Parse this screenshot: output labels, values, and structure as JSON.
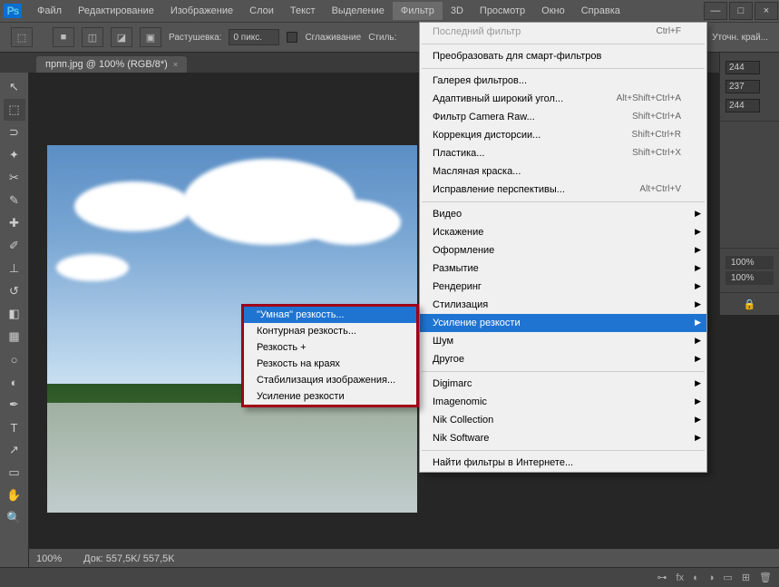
{
  "app": {
    "logo": "Ps"
  },
  "menubar": [
    "Файл",
    "Редактирование",
    "Изображение",
    "Слои",
    "Текст",
    "Выделение",
    "Фильтр",
    "3D",
    "Просмотр",
    "Окно",
    "Справка"
  ],
  "menubar_active_index": 6,
  "options": {
    "feather_label": "Растушевка:",
    "feather_value": "0 пикс.",
    "antialias": "Сглаживание",
    "style_label": "Стиль:",
    "refine": "Уточн. край..."
  },
  "tab": {
    "title": "прпп.jpg @ 100% (RGB/8*)"
  },
  "filter_menu": [
    {
      "label": "Последний фильтр",
      "shortcut": "Ctrl+F",
      "disabled": true
    },
    "sep",
    {
      "label": "Преобразовать для смарт-фильтров"
    },
    "sep",
    {
      "label": "Галерея фильтров..."
    },
    {
      "label": "Адаптивный широкий угол...",
      "shortcut": "Alt+Shift+Ctrl+A"
    },
    {
      "label": "Фильтр Camera Raw...",
      "shortcut": "Shift+Ctrl+A"
    },
    {
      "label": "Коррекция дисторсии...",
      "shortcut": "Shift+Ctrl+R"
    },
    {
      "label": "Пластика...",
      "shortcut": "Shift+Ctrl+X"
    },
    {
      "label": "Масляная краска..."
    },
    {
      "label": "Исправление перспективы...",
      "shortcut": "Alt+Ctrl+V"
    },
    "sep",
    {
      "label": "Видео",
      "sub": true
    },
    {
      "label": "Искажение",
      "sub": true
    },
    {
      "label": "Оформление",
      "sub": true
    },
    {
      "label": "Размытие",
      "sub": true
    },
    {
      "label": "Рендеринг",
      "sub": true
    },
    {
      "label": "Стилизация",
      "sub": true
    },
    {
      "label": "Усиление резкости",
      "sub": true,
      "highlighted": true
    },
    {
      "label": "Шум",
      "sub": true
    },
    {
      "label": "Другое",
      "sub": true
    },
    "sep",
    {
      "label": "Digimarc",
      "sub": true
    },
    {
      "label": "Imagenomic",
      "sub": true
    },
    {
      "label": "Nik Collection",
      "sub": true
    },
    {
      "label": "Nik Software",
      "sub": true
    },
    "sep",
    {
      "label": "Найти фильтры в Интернете..."
    }
  ],
  "sharpen_submenu": [
    {
      "label": "\"Умная\" резкость...",
      "highlighted": true
    },
    {
      "label": "Контурная резкость..."
    },
    {
      "label": "Резкость +"
    },
    {
      "label": "Резкость на краях"
    },
    {
      "label": "Стабилизация изображения..."
    },
    {
      "label": "Усиление резкости"
    }
  ],
  "right_panel": {
    "values": [
      "244",
      "237",
      "244"
    ],
    "opacity1": "100%",
    "opacity2": "100%"
  },
  "status": {
    "zoom": "100%",
    "doc": "Док: 557,5K/ 557,5K"
  }
}
